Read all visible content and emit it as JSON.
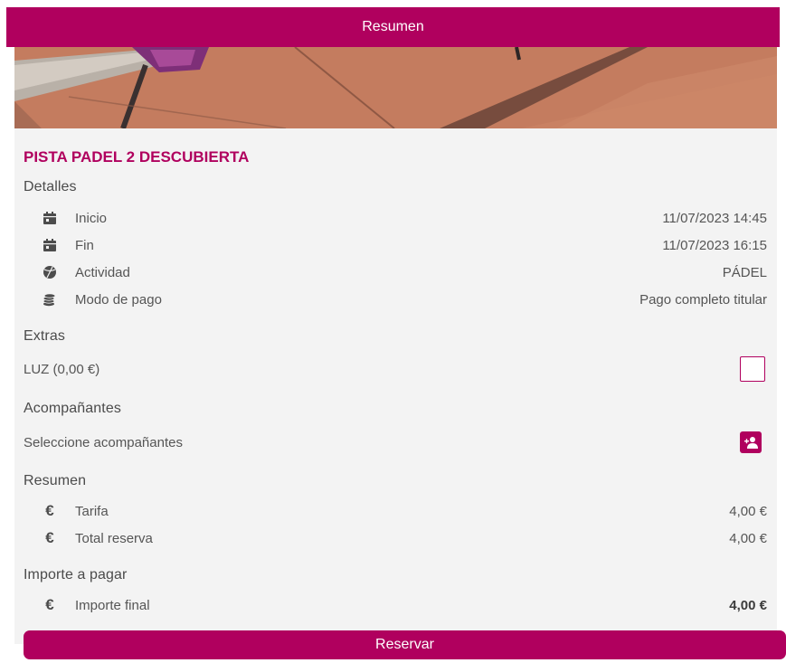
{
  "header": {
    "title": "Resumen"
  },
  "court": {
    "name": "PISTA PADEL 2 DESCUBIERTA"
  },
  "details": {
    "title": "Detalles",
    "rows": [
      {
        "icon": "calendar-icon",
        "label": "Inicio",
        "value": "11/07/2023 14:45"
      },
      {
        "icon": "calendar-icon",
        "label": "Fin",
        "value": "11/07/2023 16:15"
      },
      {
        "icon": "sport-ball-icon",
        "label": "Actividad",
        "value": "PÁDEL"
      },
      {
        "icon": "coins-icon",
        "label": "Modo de pago",
        "value": "Pago completo titular"
      }
    ]
  },
  "extras": {
    "title": "Extras",
    "items": [
      {
        "label": "LUZ (0,00 €)",
        "checked": false
      }
    ]
  },
  "companions": {
    "title": "Acompañantes",
    "prompt": "Seleccione acompañantes"
  },
  "summary": {
    "title": "Resumen",
    "rows": [
      {
        "icon": "euro-icon",
        "label": "Tarifa",
        "value": "4,00 €"
      },
      {
        "icon": "euro-icon",
        "label": "Total reserva",
        "value": "4,00 €"
      }
    ]
  },
  "payment": {
    "title": "Importe a pagar",
    "rows": [
      {
        "icon": "euro-icon",
        "label": "Importe final",
        "value": "4,00 €"
      }
    ]
  },
  "actions": {
    "reserve_label": "Reservar"
  },
  "colors": {
    "accent": "#b0005e",
    "card_bg": "#f3f3f3"
  }
}
